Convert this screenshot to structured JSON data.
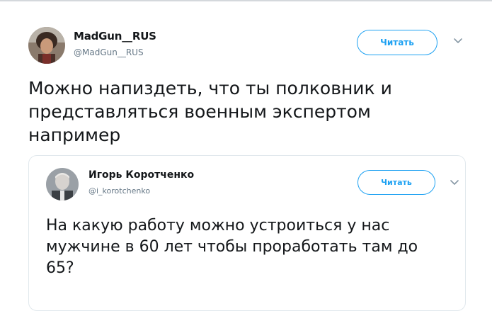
{
  "tweet": {
    "author_name": "MadGun__RUS",
    "author_handle": "@MadGun__RUS",
    "follow_label": "Читать",
    "text": "Можно напиздеть, что ты полковник и представляться военным экспертом например"
  },
  "quoted": {
    "author_name": "Игорь Коротченко",
    "author_handle": "@i_korotchenko",
    "follow_label": "Читать",
    "text": "На какую работу можно устроиться у нас мужчине в 60 лет чтобы проработать там до 65?"
  },
  "colors": {
    "accent": "#1da1f2",
    "secondary_text": "#657786",
    "border": "#e1e8ed"
  },
  "icons": {
    "menu": "chevron-down-icon"
  }
}
